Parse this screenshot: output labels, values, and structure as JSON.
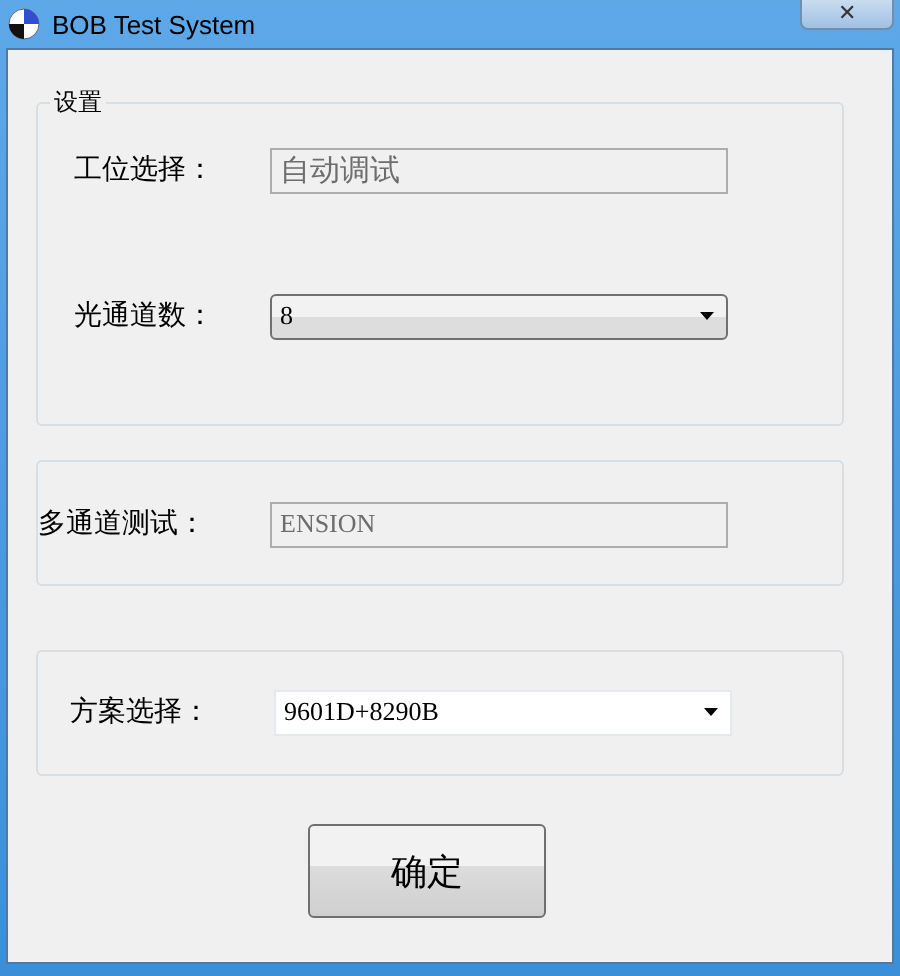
{
  "window": {
    "title": "BOB Test System",
    "close": "✕"
  },
  "groups": [
    {
      "legend": "设置",
      "fields": [
        {
          "label": "工位选择：",
          "kind": "text",
          "value": "自动调试",
          "disabled": true
        },
        {
          "label": "光通道数：",
          "kind": "dropdown",
          "value": "8",
          "editable": false
        }
      ]
    },
    {
      "fields": [
        {
          "label": "多通道测试：",
          "kind": "text",
          "value": "ENSION",
          "disabled": true
        }
      ]
    },
    {
      "fields": [
        {
          "label": "方案选择：",
          "kind": "dropdown",
          "value": "9601D+8290B",
          "editable": true
        }
      ]
    }
  ],
  "button": {
    "label": "确定"
  }
}
